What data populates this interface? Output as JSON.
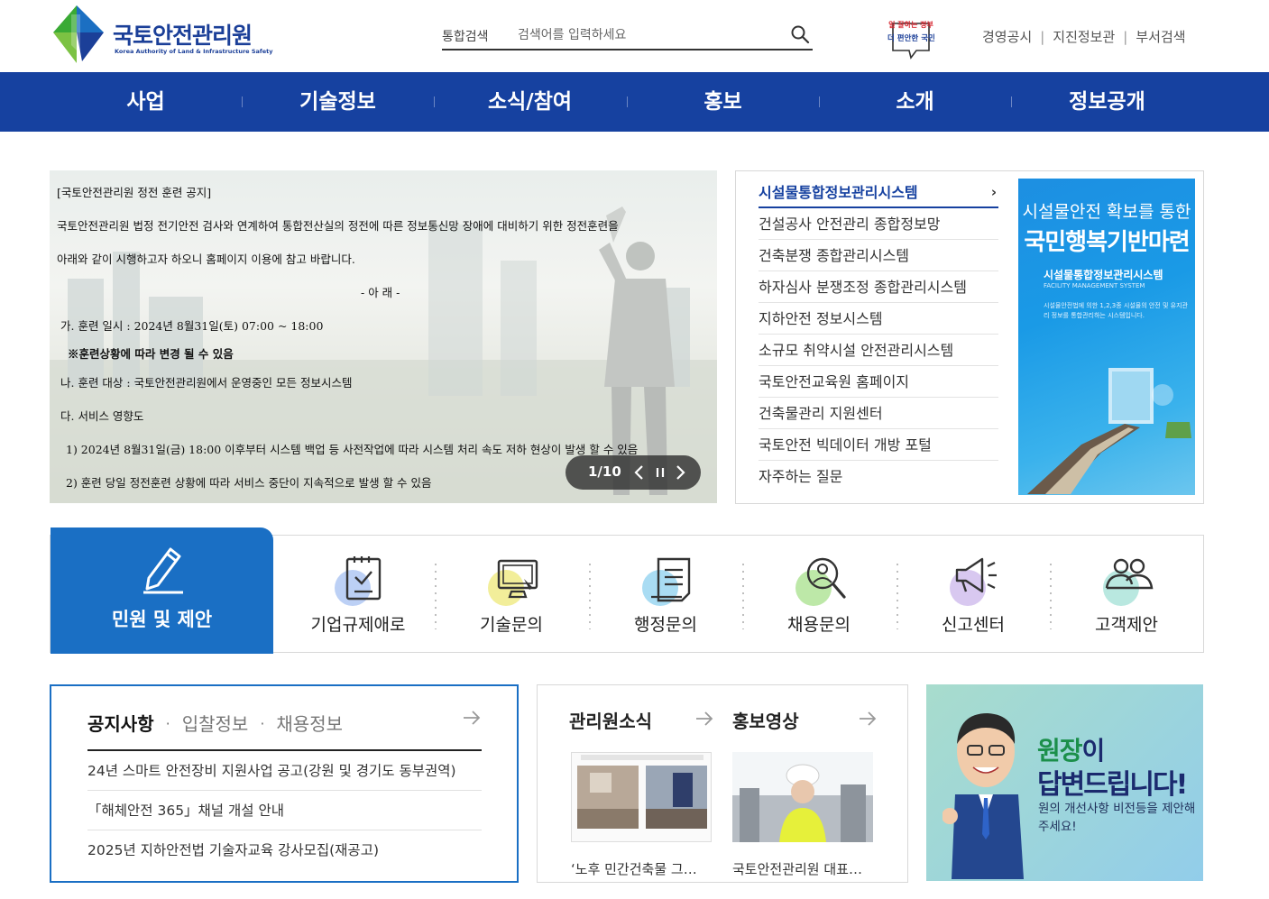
{
  "header": {
    "logo_title": "국토안전관리원",
    "logo_subtitle": "Korea Authority of Land & Infrastructure Safety",
    "search": {
      "scope": "통합검색",
      "placeholder": "검색어를 입력하세요",
      "button_icon": "search-icon"
    },
    "promo_badge": {
      "line1": "일 잘하는 정부",
      "line2": "더 편안한 국민"
    },
    "util_links": [
      "경영공시",
      "지진정보관",
      "부서검색"
    ],
    "util_separator": "|"
  },
  "nav": {
    "items": [
      "사업",
      "기술정보",
      "소식/참여",
      "홍보",
      "소개",
      "정보공개"
    ]
  },
  "hero": {
    "lines": [
      "[국토안전관리원 정전 훈련 공지]",
      "국토안전관리원 법정 전기안전 검사와 연계하여 통합전산실의 정전에 따른 정보통신망 장애에 대비하기 위한 정전훈련을",
      "아래와 같이 시행하고자 하오니 홈페이지 이용에 참고 바랍니다.",
      "- 아 래 -",
      "가. 훈련 일시 : 2024년 8월31일(토) 07:00 ~ 18:00",
      "※훈련상황에 따라 변경 될 수 있음",
      "나. 훈련 대상 : 국토안전관리원에서 운영중인 모든 정보시스템",
      "다. 서비스 영향도",
      "1) 2024년 8월31일(금) 18:00 이후부터 시스템 백업 등 사전작업에 따라 시스템 처리 속도 저하 현상이 발생 할 수 있음",
      "2) 훈련 당일 정전훈련 상황에 따라 서비스 중단이 지속적으로 발생 할 수 있음"
    ],
    "counter": "1/10",
    "controls": [
      "prev-icon",
      "pause-icon",
      "next-icon"
    ]
  },
  "systems": {
    "items": [
      "시설물통합정보관리시스템",
      "건설공사 안전관리 종합정보망",
      "건축분쟁 종합관리시스템",
      "하자심사 분쟁조정 종합관리시스템",
      "지하안전 정보시스템",
      "소규모 취약시설 안전관리시스템",
      "국토안전교육원 홈페이지",
      "건축물관리 지원센터",
      "국토안전 빅데이터 개방 포털",
      "자주하는 질문"
    ],
    "arrow": "›",
    "banner": {
      "line1": "시설물안전 확보를 통한",
      "line2": "국민행복기반마련",
      "line3": "시설물통합정보관리시스템",
      "line4": "FACILITY MANAGEMENT SYSTEM",
      "line5": "시설물안전법에 의한 1,2,3종 시설물의 안전 및 유지관리 정보를 통합관리하는 시스템입니다."
    }
  },
  "quick": {
    "main_label": "민원 및 제안",
    "items": [
      {
        "label": "기업규제애로",
        "icon": "checklist-icon",
        "color": "#bcd0f5"
      },
      {
        "label": "기술문의",
        "icon": "monitor-icon",
        "color": "#f2ee9a"
      },
      {
        "label": "행정문의",
        "icon": "document-icon",
        "color": "#a9dcf3"
      },
      {
        "label": "채용문의",
        "icon": "magnifier-person-icon",
        "color": "#bde8a8"
      },
      {
        "label": "신고센터",
        "icon": "megaphone-icon",
        "color": "#d8c8f0"
      },
      {
        "label": "고객제안",
        "icon": "people-icon",
        "color": "#b9e8e0"
      }
    ]
  },
  "notice": {
    "tabs": [
      "공지사항",
      "입찰정보",
      "채용정보"
    ],
    "active_tab": "공지사항",
    "items": [
      "24년 스마트 안전장비 지원사업 공고(강원 및 경기도 동부권역)",
      "「해체안전 365」채널 개설 안내",
      "2025년 지하안전법 기술자교육 강사모집(재공고)"
    ]
  },
  "news": {
    "titles": [
      "관리원소식",
      "홍보영상"
    ],
    "captions": [
      "‘노후 민간건축물 그…",
      "국토안전관리원 대표…"
    ]
  },
  "ceo_banner": {
    "title_highlight": "원장",
    "title_rest": "이",
    "title2": "답변드립니다!",
    "desc": "원의 개선사항 비전등을 제안해주세요!"
  },
  "colors": {
    "brand_blue": "#1641a0",
    "quick_blue": "#1a6fc4",
    "brand_green": "#3aaa35"
  }
}
